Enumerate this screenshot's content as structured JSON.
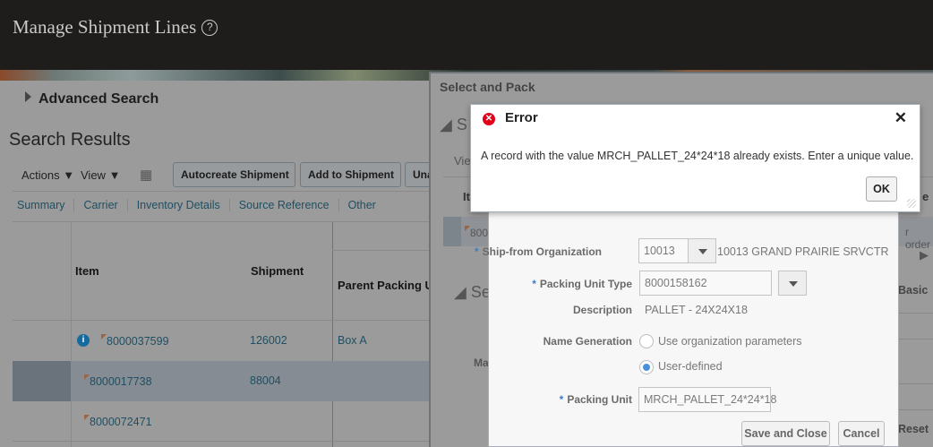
{
  "page": {
    "title": "Manage Shipment Lines",
    "help_icon": "?"
  },
  "search": {
    "advanced_search": "Advanced Search",
    "results_title": "Search Results"
  },
  "toolbar": {
    "actions": "Actions",
    "view": "View",
    "autocreate": "Autocreate Shipment",
    "add_to_shipment": "Add to Shipment",
    "unassign": "Una"
  },
  "tabs": [
    "Summary",
    "Carrier",
    "Inventory Details",
    "Source Reference",
    "Other"
  ],
  "table": {
    "headers": {
      "item": "Item",
      "shipment": "Shipment",
      "parent": "Parent Packing U"
    },
    "rows": [
      {
        "item": "8000037599",
        "shipment": "126002",
        "parent": "Box A"
      },
      {
        "item": "8000017738",
        "shipment": "88004",
        "parent": ""
      },
      {
        "item": "8000072471",
        "shipment": "",
        "parent": ""
      }
    ]
  },
  "select_and_pack": {
    "title": "Select and Pack",
    "section1": "S",
    "view": "Vie",
    "col_item": "It",
    "col_e": "e",
    "row_item": "800",
    "row_order": "r order",
    "section2": "Se",
    "basic": "Basic",
    "ma": "Ma",
    "reset": "Reset"
  },
  "form": {
    "ship_from_label": "Ship-from Organization",
    "ship_from_value": "10013",
    "ship_from_desc": "10013 GRAND PRAIRIE SRVCTR",
    "packing_unit_type_label": "Packing Unit Type",
    "packing_unit_type_value": "8000158162",
    "description_label": "Description",
    "description_value": "PALLET - 24X24X18",
    "name_generation_label": "Name Generation",
    "option_org": "Use organization parameters",
    "option_user": "User-defined",
    "selected_option": "User-defined",
    "packing_unit_label": "Packing Unit",
    "packing_unit_value": "MRCH_PALLET_24*24*18",
    "save_close": "Save and Close",
    "cancel": "Cancel"
  },
  "error": {
    "title": "Error",
    "message": "A record with the value MRCH_PALLET_24*24*18 already exists. Enter a unique value.",
    "ok": "OK",
    "close": "✕"
  }
}
